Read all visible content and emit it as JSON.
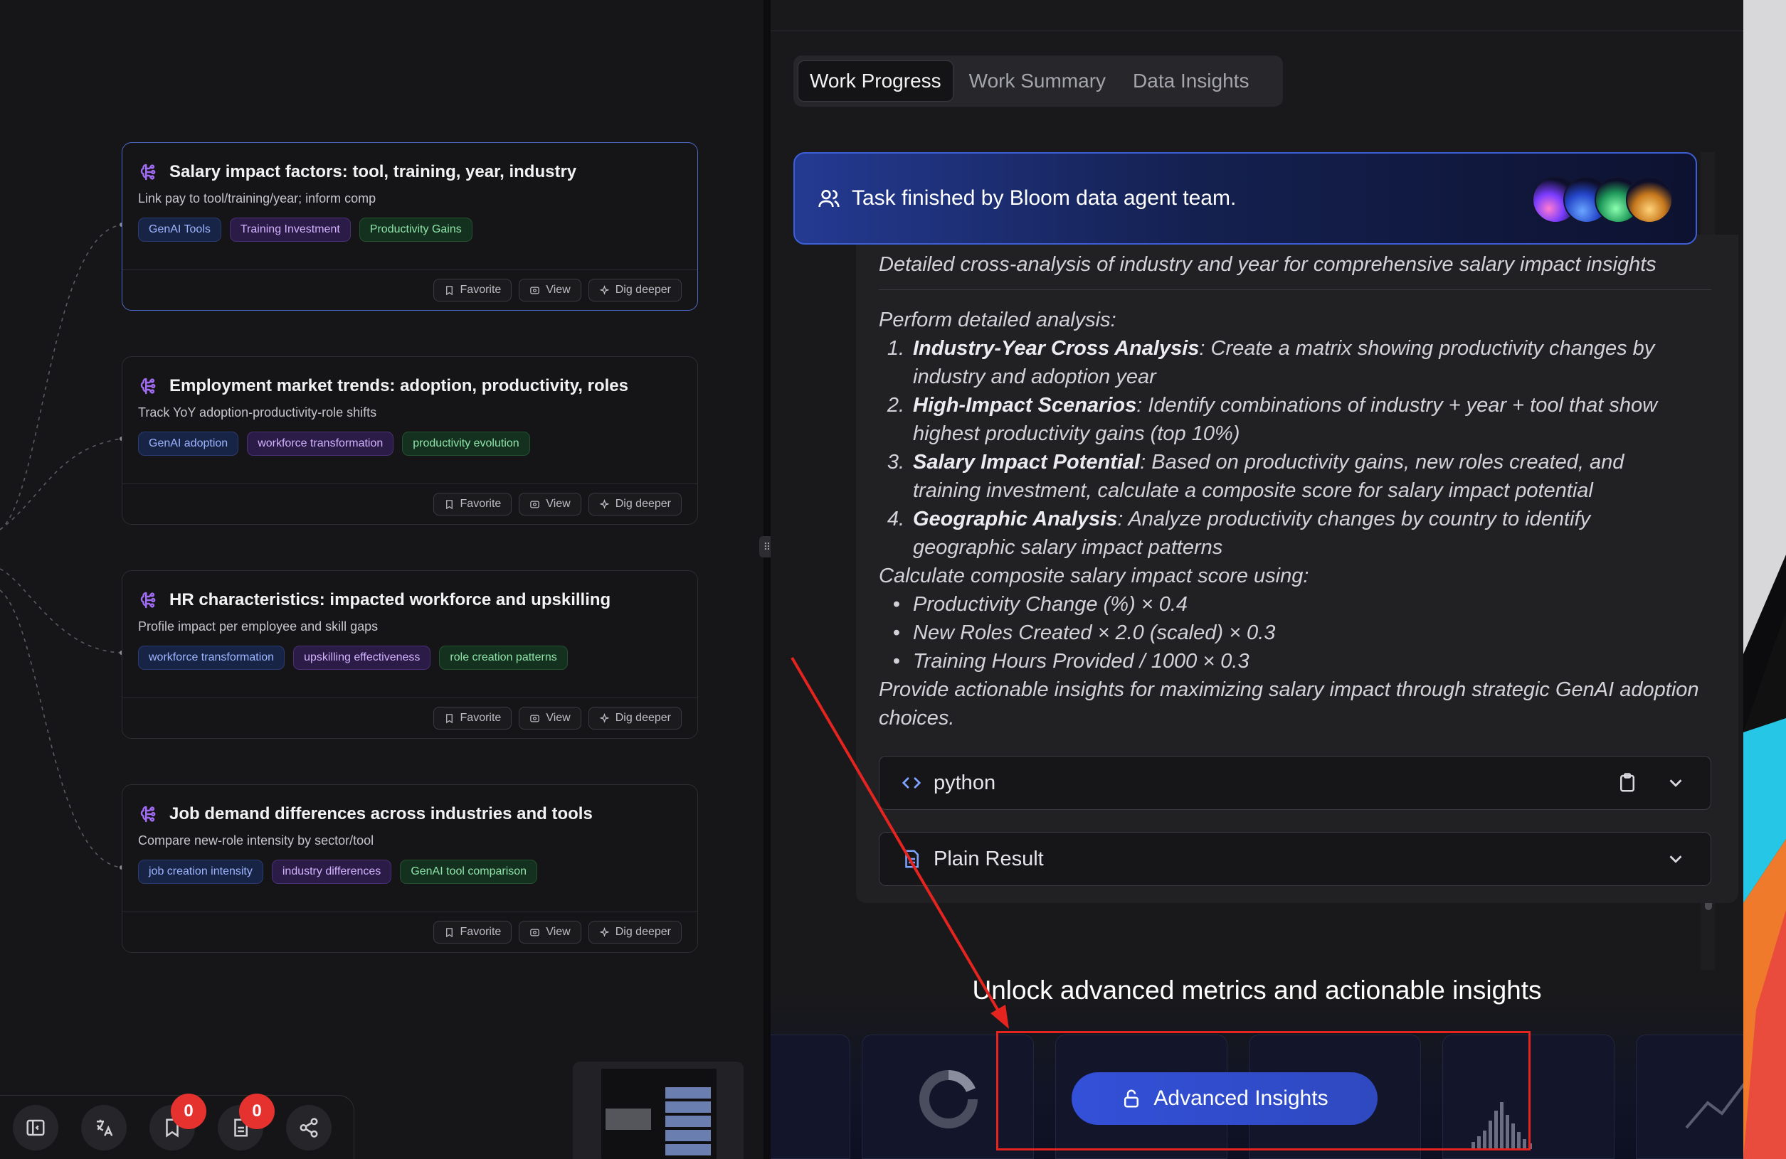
{
  "canvas": {
    "cards": [
      {
        "title": "Salary impact factors: tool, training, year, industry",
        "desc": "Link pay to tool/training/year; inform comp",
        "tags": [
          {
            "label": "GenAI Tools",
            "color": "blue"
          },
          {
            "label": "Training Investment",
            "color": "purple"
          },
          {
            "label": "Productivity Gains",
            "color": "green"
          }
        ],
        "selected": true
      },
      {
        "title": "Employment market trends: adoption, productivity, roles",
        "desc": "Track YoY adoption-productivity-role shifts",
        "tags": [
          {
            "label": "GenAI adoption",
            "color": "blue"
          },
          {
            "label": "workforce transformation",
            "color": "purple"
          },
          {
            "label": "productivity evolution",
            "color": "green"
          }
        ],
        "selected": false
      },
      {
        "title": "HR characteristics: impacted workforce and upskilling",
        "desc": "Profile impact per employee and skill gaps",
        "tags": [
          {
            "label": "workforce transformation",
            "color": "blue"
          },
          {
            "label": "upskilling effectiveness",
            "color": "purple"
          },
          {
            "label": "role creation patterns",
            "color": "green"
          }
        ],
        "selected": false
      },
      {
        "title": "Job demand differences across industries and tools",
        "desc": "Compare new-role intensity by sector/tool",
        "tags": [
          {
            "label": "job creation intensity",
            "color": "blue"
          },
          {
            "label": "industry differences",
            "color": "purple"
          },
          {
            "label": "GenAI tool comparison",
            "color": "green"
          }
        ],
        "selected": false
      }
    ],
    "actions": {
      "favorite": "Favorite",
      "view": "View",
      "dig": "Dig deeper"
    }
  },
  "toolbar": {
    "favorites_count": "0",
    "documents_count": "0",
    "icons": [
      "sidebar-toggle-icon",
      "translate-icon",
      "bookmark-icon",
      "document-icon",
      "share-icon"
    ]
  },
  "panel": {
    "tabs": [
      "Work Progress",
      "Work Summary",
      "Data Insights"
    ],
    "active_tab": "Work Progress",
    "banner": "Task finished by Bloom data agent team.",
    "subtitle": "Detailed cross-analysis of industry and year for comprehensive salary impact insights",
    "intro": "Perform detailed analysis:",
    "steps": [
      {
        "num": "1.",
        "title": "Industry-Year Cross Analysis",
        "text": ": Create a matrix showing productivity changes by industry and adoption year"
      },
      {
        "num": "2.",
        "title": "High-Impact Scenarios",
        "text": ": Identify combinations of industry + year + tool that show highest productivity gains (top 10%)"
      },
      {
        "num": "3.",
        "title": "Salary Impact Potential",
        "text": ": Based on productivity gains, new roles created, and training investment, calculate a composite score for salary impact potential"
      },
      {
        "num": "4.",
        "title": "Geographic Analysis",
        "text": ": Analyze productivity changes by country to identify geographic salary impact patterns"
      }
    ],
    "score_intro": "Calculate composite salary impact score using:",
    "score_items": [
      "Productivity Change (%) × 0.4",
      "New Roles Created × 2.0 (scaled) × 0.3",
      "Training Hours Provided / 1000 × 0.3"
    ],
    "conclusion": "Provide actionable insights for maximizing salary impact through strategic GenAI adoption choices.",
    "code_label": "python",
    "result_label": "Plain Result",
    "unlock_text": "Unlock advanced metrics and actionable insights",
    "advanced_button": "Advanced Insights"
  },
  "colors": {
    "accent_blue": "#3350d8",
    "highlight_red": "#e52420",
    "badge_red": "#e5322f"
  }
}
